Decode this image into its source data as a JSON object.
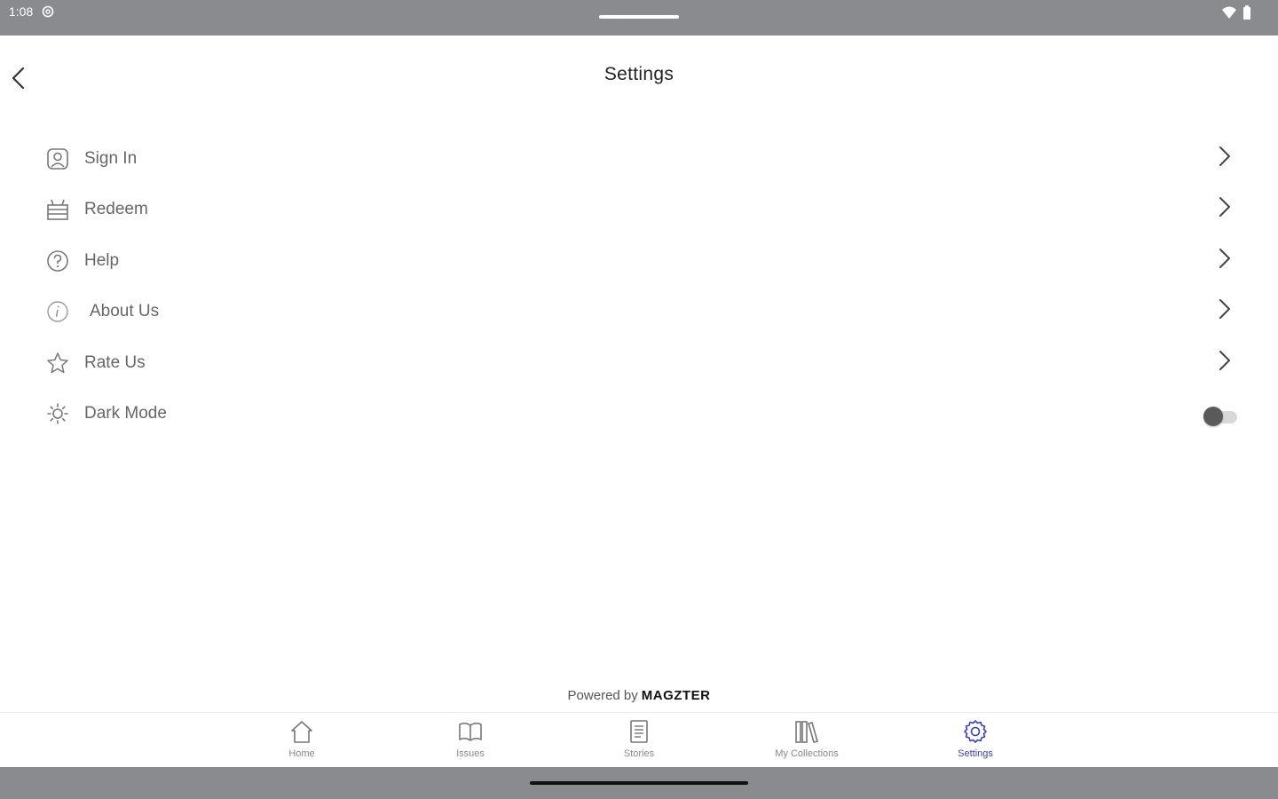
{
  "status_bar": {
    "time": "1:08",
    "icons": [
      "settings-gear-icon",
      "wifi-icon",
      "battery-icon"
    ]
  },
  "header": {
    "title": "Settings",
    "back_icon": "chevron-left-icon"
  },
  "settings": {
    "items": [
      {
        "label": "Sign In",
        "icon": "user-icon"
      },
      {
        "label": "Redeem",
        "icon": "gift-icon"
      },
      {
        "label": "Help",
        "icon": "help-circle-icon"
      },
      {
        "label": "About Us",
        "icon": "info-circle-icon"
      },
      {
        "label": "Rate Us",
        "icon": "star-icon"
      },
      {
        "label": "Dark Mode",
        "icon": "sun-icon",
        "toggle_on": false
      }
    ]
  },
  "footer": {
    "powered_by": "Powered by",
    "brand": "MAGZTER"
  },
  "bottom_nav": {
    "items": [
      {
        "label": "Home",
        "icon": "home-icon"
      },
      {
        "label": "Issues",
        "icon": "book-icon"
      },
      {
        "label": "Stories",
        "icon": "document-icon"
      },
      {
        "label": "My Collections",
        "icon": "library-icon"
      },
      {
        "label": "Settings",
        "icon": "gear-icon",
        "active": true
      }
    ]
  },
  "colors": {
    "system_bar": "#8a8b8f",
    "active_tab": "#3b3fbf",
    "label_text": "#666666"
  }
}
